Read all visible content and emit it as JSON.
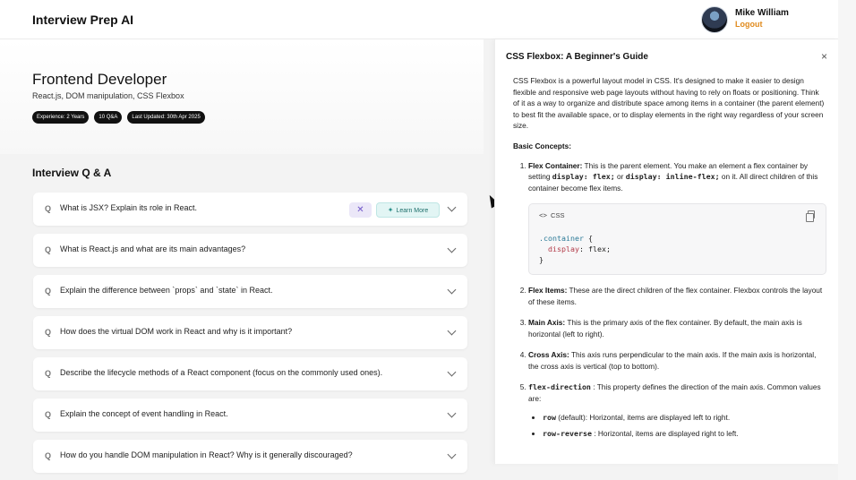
{
  "header": {
    "brand": "Interview Prep AI",
    "user_name": "Mike William",
    "logout_label": "Logout"
  },
  "hero": {
    "role": "Frontend Developer",
    "topics": "React.js, DOM manipulation, CSS Flexbox",
    "badges": [
      "Experience: 2 Years",
      "10 Q&A",
      "Last Updated: 30th Apr 2025"
    ]
  },
  "qa": {
    "title": "Interview Q & A",
    "q_marker": "Q",
    "learn_more_label": "Learn More",
    "items": [
      "What is JSX? Explain its role in React.",
      "What is React.js and what are its main advantages?",
      "Explain the difference between `props` and `state` in React.",
      "How does the virtual DOM work in React and why is it important?",
      "Describe the lifecycle methods of a React component (focus on the commonly used ones).",
      "Explain the concept of event handling in React.",
      "How do you handle DOM manipulation in React? Why is it generally discouraged?"
    ]
  },
  "drawer": {
    "title": "CSS Flexbox: A Beginner's Guide",
    "close_glyph": "×",
    "intro": "CSS Flexbox is a powerful layout model in CSS. It's designed to make it easier to design flexible and responsive web page layouts without having to rely on floats or positioning. Think of it as a way to organize and distribute space among items in a container (the parent element) to best fit the available space, or to display elements in the right way regardless of your screen size.",
    "basic_heading": "Basic Concepts:",
    "concept1": {
      "term": "Flex Container:",
      "text_a": " This is the parent element. You make an element a flex container by setting ",
      "code_a": "display: flex;",
      "text_b": " or ",
      "code_b": "display: inline-flex;",
      "text_c": " on it. All direct children of this container become flex items."
    },
    "code": {
      "lang": "CSS",
      "lang_glyph": "<>",
      "line1_selector": ".container",
      "line1_brace": " {",
      "line2_prop": "display",
      "line2_value": ": flex;",
      "line3": "}"
    },
    "concept2": {
      "term": "Flex Items:",
      "text": " These are the direct children of the flex container. Flexbox controls the layout of these items."
    },
    "concept3": {
      "term": "Main Axis:",
      "text": " This is the primary axis of the flex container. By default, the main axis is horizontal (left to right)."
    },
    "concept4": {
      "term": "Cross Axis:",
      "text": " This axis runs perpendicular to the main axis. If the main axis is horizontal, the cross axis is vertical (top to bottom)."
    },
    "concept5": {
      "term": "flex-direction",
      "text": " : This property defines the direction of the main axis. Common values are:",
      "values": [
        {
          "code": "row",
          "text": " (default): Horizontal, items are displayed left to right."
        },
        {
          "code": "row-reverse",
          "text": " : Horizontal, items are displayed right to left."
        }
      ]
    }
  },
  "colors": {
    "accent_orange": "#e08a1c",
    "learn_more_bg": "#e2f5f4",
    "pin_bg": "#ebe7f8",
    "badge_bg": "#111111"
  },
  "icons": [
    "avatar",
    "search-q-icon",
    "pin-icon",
    "sparkle-icon",
    "chevron-down-icon",
    "close-icon",
    "code-icon",
    "copy-icon",
    "cursor-pointer"
  ]
}
